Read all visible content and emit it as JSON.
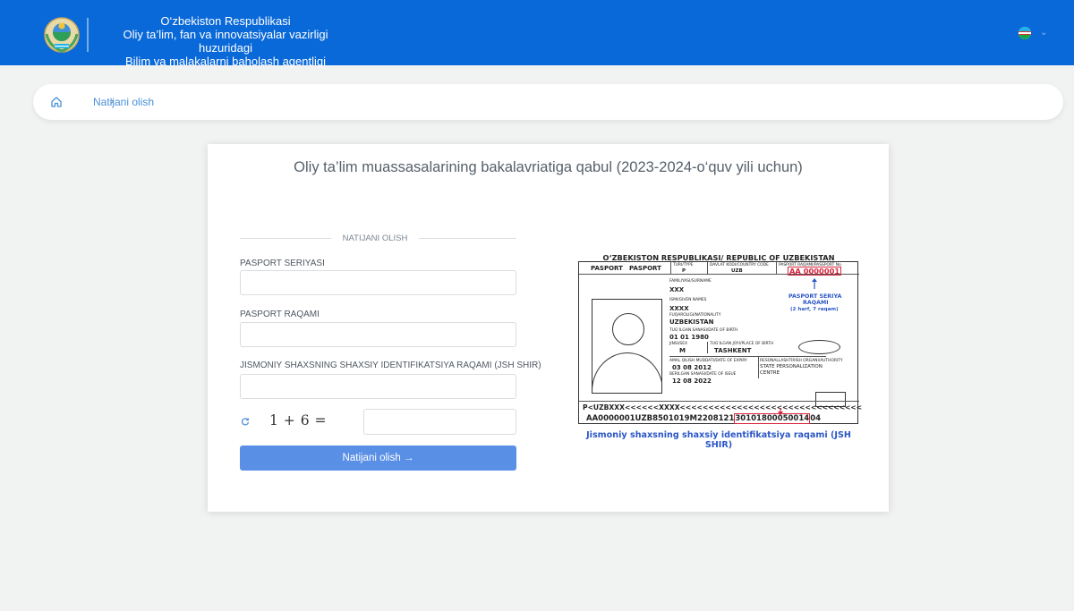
{
  "header": {
    "org_line1": "O‘zbekiston Respublikasi",
    "org_line2": "Oliy ta’lim, fan va innovatsiyalar vazirligi huzuridagi",
    "org_line3": "Bilim va malakalarni baholash agentligi",
    "emblem_icon": "uzbekistan-emblem-icon",
    "language_flag_icon": "uzbekistan-flag-icon",
    "brand_color": "#0a69d8"
  },
  "breadcrumb": {
    "home_icon": "home-icon",
    "separator": "›",
    "current": "Natijani olish"
  },
  "card": {
    "title": "Oliy ta’lim muassasalarining bakalavriatiga qabul (2023-2024-o‘quv yili uchun)",
    "legend": "NATIJANI OLISH",
    "fields": {
      "passport_series_label": "PASPORT SERIYASI",
      "passport_number_label": "PASPORT RAQAMI",
      "jshshir_label": "JISMONIY SHAXSNING SHAXSIY IDENTIFIKATSIYA RAQAMI (JSH SHIR)"
    },
    "captcha": {
      "expression": "1 + 6 =",
      "refresh_icon": "refresh-icon"
    },
    "submit_label": "Natijani olish →",
    "submit_color": "#5a8fe6"
  },
  "passport": {
    "header": "O‘ZBEKISTON RESPUBLIKASI/ REPUBLIC OF UZBEKISTAN",
    "doc_label1": "PASPORT",
    "doc_label2": "PASPORT",
    "type_label": "TURI/TYPE",
    "type_value": "P",
    "country_label": "DAVLAT KODI/COUNTRY CODE",
    "country_value": "UZB",
    "number_label": "PASPORT RAQAMI/PASSPORT No.",
    "number_value": "AA 0000001",
    "surname_label": "FAMILIYASI/SURNAME",
    "surname_value": "XXX",
    "given_label": "ISMI/GIVEN NAMES",
    "given_value": "XXXX",
    "nationality_label": "FUQAROLIGI/NATIONALITY",
    "nationality_value": "UZBEKISTAN",
    "dob_label": "TUG‘ILGAN SANASI/DATE OF BIRTH",
    "dob_value": "01  01  1980",
    "sex_label": "JINSI/SEX",
    "sex_value": "M",
    "pob_label": "TUG‘ILGAN JOYI/PLACE OF BIRTH",
    "pob_value": "TASHKENT",
    "expiry_label": "AMAL QILISH MUDDATI/DATE OF EXPIRY",
    "expiry_value": "03  08  2012",
    "issue_label": "BERILGAN SANASI/DATE OF ISSUE",
    "issue_value": "12  08  2022",
    "authority_label": "RESONALLASHTIRISH ORGANI/AUTHORITY",
    "authority_value1": "STATE PERSONALIZATION",
    "authority_value2": "CENTRE",
    "series_hint1": "PASPORT SERIYA",
    "series_hint2": "RAQAMI",
    "series_hint3": "(2 harf, 7 raqam)",
    "mrz_line1": "P<UZBXXX<<<<<<XXXX<<<<<<<<<<<<<<<<<<<<<<<<<<<<<<<<",
    "mrz_line2_a": "AA0000001UZB8501019M2208121",
    "mrz_line2_hl": "30101800050014",
    "mrz_line2_b": "04",
    "caption": "Jismoniy shaxsning shaxsiy identifikatsiya raqami (JSH SHIR)",
    "highlight_color": "#d7263d",
    "hint_color": "#2a56c6"
  }
}
